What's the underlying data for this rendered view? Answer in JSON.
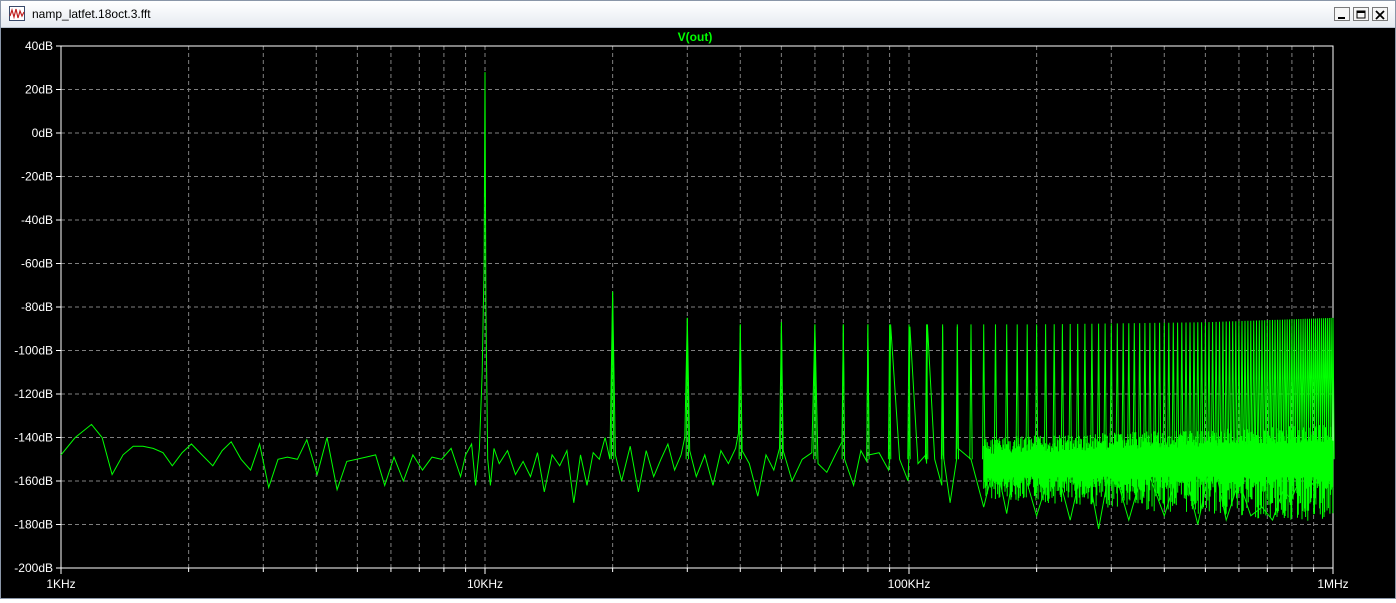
{
  "window": {
    "title": "namp_latfet.18oct.3.fft",
    "icon": "waveform-plot-icon",
    "controls": [
      "minimize-icon",
      "maximize-icon",
      "close-icon"
    ]
  },
  "colors": {
    "trace": "#00ff00",
    "background": "#000000",
    "grid": "#7f7f7f",
    "axis_text": "#ffffff"
  },
  "chart_data": {
    "type": "line",
    "title": "V(out)",
    "xscale": "log",
    "xlim_hz": [
      1000,
      1000000
    ],
    "ylim_db": [
      -200,
      40
    ],
    "grid": true,
    "x_ticks": [
      {
        "value": 1000,
        "label": "1KHz"
      },
      {
        "value": 10000,
        "label": "10KHz"
      },
      {
        "value": 100000,
        "label": "100KHz"
      },
      {
        "value": 1000000,
        "label": "1MHz"
      }
    ],
    "y_ticks": [
      {
        "value": 40,
        "label": "40dB"
      },
      {
        "value": 20,
        "label": "20dB"
      },
      {
        "value": 0,
        "label": "0dB"
      },
      {
        "value": -20,
        "label": "-20dB"
      },
      {
        "value": -40,
        "label": "-40dB"
      },
      {
        "value": -60,
        "label": "-60dB"
      },
      {
        "value": -80,
        "label": "-80dB"
      },
      {
        "value": -100,
        "label": "-100dB"
      },
      {
        "value": -120,
        "label": "-120dB"
      },
      {
        "value": -140,
        "label": "-140dB"
      },
      {
        "value": -160,
        "label": "-160dB"
      },
      {
        "value": -180,
        "label": "-180dB"
      },
      {
        "value": -200,
        "label": "-200dB"
      }
    ],
    "series": [
      {
        "name": "V(out)",
        "x": [
          1000,
          1080,
          1180,
          1250,
          1320,
          1400,
          1480,
          1560,
          1650,
          1740,
          1830,
          1930,
          2030,
          2150,
          2280,
          2400,
          2520,
          2660,
          2800,
          2940,
          3090,
          3250,
          3420,
          3610,
          3800,
          4020,
          4240,
          4480,
          4720,
          4980,
          5240,
          5520,
          5800,
          6100,
          6420,
          6760,
          7120,
          7500,
          7900,
          8320,
          8760,
          9000,
          9300,
          9500,
          9700,
          9850,
          9950,
          10000,
          10050,
          10150,
          10300,
          10500,
          10800,
          11300,
          11800,
          12300,
          12800,
          13300,
          13800,
          14400,
          15000,
          15600,
          16200,
          16800,
          17400,
          18000,
          18600,
          19200,
          19700,
          20000,
          20300,
          21000,
          22000,
          23000,
          24000,
          25000,
          26000,
          27000,
          28000,
          29000,
          29600,
          30000,
          30400,
          31500,
          33000,
          34500,
          36000,
          37500,
          39000,
          39600,
          40000,
          40400,
          42000,
          44000,
          46000,
          48000,
          49500,
          50000,
          50500,
          53000,
          56000,
          59000,
          60000,
          61000,
          64000,
          67000,
          69500,
          70000,
          70500,
          74000,
          77000,
          79500,
          80000,
          80500,
          85000,
          89500,
          90000,
          90500,
          95000,
          99500,
          100000,
          100500,
          105000,
          109500,
          110000,
          110500,
          115000,
          119500,
          120000,
          120500,
          125000,
          129500,
          130000,
          130500,
          140000,
          150000,
          160000,
          170000,
          180000,
          200000,
          220000,
          240000,
          260000,
          280000,
          300000,
          330000,
          360000,
          400000,
          440000,
          480000,
          520000,
          560000,
          600000,
          640000,
          680000,
          720000,
          760000,
          800000,
          850000,
          900000,
          950000,
          1000000
        ],
        "y": [
          -148,
          -140,
          -134,
          -140,
          -157,
          -148,
          -144,
          -144,
          -145,
          -147,
          -153,
          -147,
          -143,
          -148,
          -153,
          -146,
          -142,
          -150,
          -155,
          -143,
          -163,
          -150,
          -149,
          -150,
          -141,
          -157,
          -140,
          -164,
          -151,
          -150,
          -149,
          -148,
          -162,
          -149,
          -160,
          -148,
          -155,
          -149,
          -150,
          -145,
          -158,
          -148,
          -143,
          -162,
          -145,
          -110,
          -60,
          28,
          -80,
          -150,
          -162,
          -145,
          -152,
          -146,
          -157,
          -151,
          -158,
          -147,
          -165,
          -148,
          -153,
          -146,
          -170,
          -148,
          -162,
          -147,
          -150,
          -140,
          -150,
          -73,
          -148,
          -160,
          -144,
          -165,
          -146,
          -158,
          -150,
          -143,
          -155,
          -148,
          -140,
          -85,
          -146,
          -158,
          -148,
          -162,
          -146,
          -152,
          -145,
          -138,
          -88,
          -146,
          -152,
          -167,
          -148,
          -155,
          -145,
          -87,
          -146,
          -160,
          -150,
          -147,
          -88,
          -152,
          -156,
          -148,
          -142,
          -88,
          -150,
          -162,
          -146,
          -151,
          -88,
          -148,
          -147,
          -155,
          -150,
          -88,
          -150,
          -160,
          -145,
          -89,
          -152,
          -148,
          -152,
          -88,
          -150,
          -162,
          -89,
          -148,
          -170,
          -150,
          -89,
          -145,
          -150,
          -172,
          -150,
          -175,
          -145,
          -176,
          -150,
          -178,
          -148,
          -182,
          -150,
          -178,
          -152,
          -176,
          -150,
          -180,
          -148,
          -178,
          -160,
          -176,
          -172,
          -178,
          -165,
          -168,
          -155,
          -162,
          -158,
          -163
        ],
        "harmonic_peaks_db": [
          {
            "f": 20000,
            "db": -73
          },
          {
            "f": 30000,
            "db": -85
          },
          {
            "f": 40000,
            "db": -88
          },
          {
            "f": 50000,
            "db": -87
          },
          {
            "f": 60000,
            "db": -88
          },
          {
            "f": 70000,
            "db": -88
          },
          {
            "f": 80000,
            "db": -88
          },
          {
            "f": 100000,
            "db": -88
          },
          {
            "f": 200000,
            "db": -88
          },
          {
            "f": 500000,
            "db": -87
          },
          {
            "f": 1000000,
            "db": -85
          }
        ]
      }
    ]
  }
}
